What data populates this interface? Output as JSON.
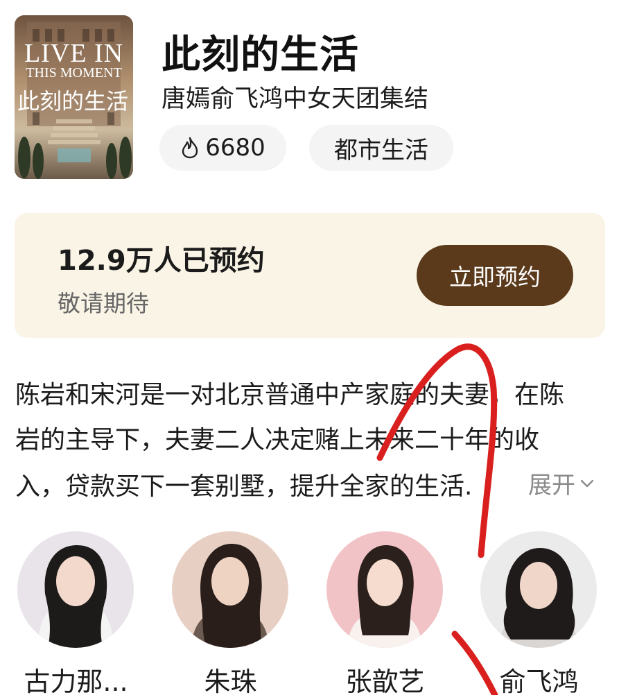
{
  "show": {
    "title": "此刻的生活",
    "subtitle": "唐嫣俞飞鸿中女天团集结",
    "heat": "6680",
    "genre": "都市生活",
    "poster": {
      "title_line1": "LIVE IN",
      "title_line2": "THIS MOMENT",
      "title_cn": "此刻的生活"
    }
  },
  "reservation": {
    "count_text": "12.9万人已预约",
    "note": "敬请期待",
    "button_label": "立即预约"
  },
  "synopsis": {
    "line1": "陈岩和宋河是一对北京普通中产家庭的夫妻，在陈",
    "line2": "岩的主导下，夫妻二人决定赌上未来二十年的收",
    "line3": "入，贷款买下一套别墅，提升全家的生活.",
    "expand_label": "展开"
  },
  "cast": [
    {
      "name": "古力那..."
    },
    {
      "name": "朱珠"
    },
    {
      "name": "张歆艺"
    },
    {
      "name": "俞飞鸿"
    }
  ],
  "colors": {
    "reserve_card_bg": "#faf4e6",
    "reserve_button_bg": "#5b3a1c",
    "chip_bg": "#f4f4f4",
    "annotation_red": "#d9201e"
  },
  "icons": {
    "heat": "flame-icon",
    "expand": "chevron-down-icon"
  }
}
